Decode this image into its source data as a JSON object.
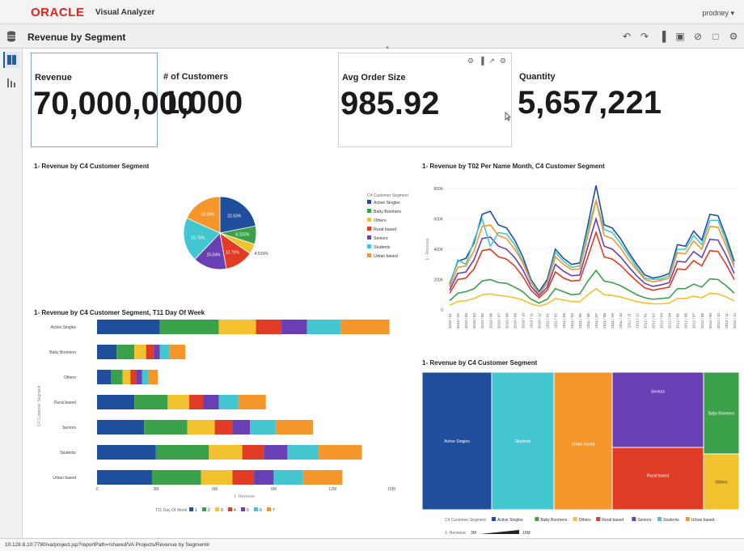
{
  "app": {
    "logo": "ORACLE",
    "name": "Visual Analyzer",
    "user": "prodney ▾"
  },
  "page": {
    "title": "Revenue by Segment"
  },
  "toolbar": {
    "icons": [
      "undo-icon",
      "redo-icon",
      "add-visualization-icon",
      "save-icon",
      "refresh-icon",
      "export-icon",
      "settings-icon"
    ],
    "glyphs": [
      "↶",
      "↷",
      "▐",
      "▣",
      "⊘",
      "□",
      "⚙"
    ]
  },
  "tiles": [
    {
      "label": "Revenue",
      "value": "70,000,000"
    },
    {
      "label": "# of Customers",
      "value": "1,000"
    },
    {
      "label": "Avg Order Size",
      "value": "985.92"
    },
    {
      "label": "Quantity",
      "value": "5,657,221"
    }
  ],
  "tile_tools": [
    "⚙",
    "▐",
    "↗",
    "⚙"
  ],
  "colors": {
    "Active Singles": "#1f4e9c",
    "Baby Boomers": "#3aa14a",
    "Others": "#f2c12e",
    "Rural based": "#e03b24",
    "Seniors": "#6b3fb4",
    "Students": "#43c6d0",
    "Urban based": "#f5962a"
  },
  "status_url": "10.128.8.10:7780/va/project.jsp?reportPath=/shared/VA Projects/Revenue by Segment#",
  "chart_data": [
    {
      "type": "pie",
      "title": "1- Revenue by C4 Customer Segment",
      "legend_title": "C4 Customer Segment",
      "legend_position": "right",
      "categories": [
        "Active Singles",
        "Baby Boomers",
        "Others",
        "Rural based",
        "Seniors",
        "Students",
        "Urban based"
      ],
      "values": [
        22.03,
        8.155,
        4.515,
        12.75,
        15.04,
        19.76,
        18.34
      ],
      "labels": [
        "22.03%",
        "8.155%",
        "4.515%",
        "12.75%",
        "15.04%",
        "19.76%",
        "18.34%"
      ]
    },
    {
      "type": "line",
      "title": "1- Revenue by T02 Per Name Month, C4 Customer Segment",
      "xlabel": "T02 Per Name Month",
      "ylabel": "1 - Revenue",
      "ylim": [
        0,
        800000
      ],
      "y_ticks": [
        "0",
        "200K",
        "400K",
        "600K",
        "800K"
      ],
      "legend_title": "C4 Customer Segment",
      "legend_position": "bottom",
      "x": [
        "2010 / 01",
        "2010 / 02",
        "2010 / 03",
        "2010 / 04",
        "2010 / 05",
        "2010 / 06",
        "2010 / 07",
        "2010 / 08",
        "2010 / 09",
        "2010 / 10",
        "2010 / 11",
        "2010 / 12",
        "2011 / 01",
        "2011 / 02",
        "2011 / 03",
        "2011 / 04",
        "2011 / 05",
        "2011 / 06",
        "2011 / 07",
        "2011 / 08",
        "2011 / 09",
        "2011 / 10",
        "2011 / 11",
        "2011 / 12",
        "2012 / 01",
        "2012 / 02",
        "2012 / 03",
        "2012 / 04",
        "2012 / 05",
        "2012 / 06",
        "2012 / 07",
        "2012 / 08",
        "2012 / 09",
        "2012 / 10",
        "2012 / 11",
        "2012 / 12"
      ],
      "series": [
        {
          "name": "Active Singles",
          "values": [
            170000,
            320000,
            340000,
            440000,
            630000,
            650000,
            560000,
            540000,
            460000,
            350000,
            200000,
            120000,
            200000,
            400000,
            340000,
            300000,
            310000,
            560000,
            820000,
            560000,
            540000,
            470000,
            380000,
            300000,
            230000,
            210000,
            220000,
            240000,
            430000,
            420000,
            520000,
            460000,
            630000,
            620000,
            480000,
            320000
          ]
        },
        {
          "name": "Baby Boomers",
          "values": [
            60000,
            110000,
            120000,
            140000,
            190000,
            200000,
            180000,
            175000,
            150000,
            120000,
            70000,
            45000,
            70000,
            140000,
            120000,
            100000,
            105000,
            190000,
            260000,
            190000,
            180000,
            160000,
            130000,
            100000,
            80000,
            70000,
            75000,
            80000,
            140000,
            140000,
            170000,
            150000,
            205000,
            200000,
            160000,
            110000
          ]
        },
        {
          "name": "Others",
          "values": [
            30000,
            55000,
            60000,
            75000,
            100000,
            105000,
            95000,
            90000,
            80000,
            65000,
            40000,
            25000,
            40000,
            75000,
            65000,
            55000,
            55000,
            100000,
            140000,
            100000,
            95000,
            85000,
            70000,
            55000,
            45000,
            40000,
            40000,
            45000,
            75000,
            75000,
            90000,
            80000,
            110000,
            105000,
            85000,
            60000
          ]
        },
        {
          "name": "Rural based",
          "values": [
            110000,
            200000,
            210000,
            270000,
            390000,
            400000,
            350000,
            335000,
            290000,
            220000,
            130000,
            80000,
            130000,
            250000,
            210000,
            190000,
            195000,
            350000,
            510000,
            350000,
            335000,
            295000,
            240000,
            190000,
            145000,
            130000,
            140000,
            150000,
            270000,
            265000,
            325000,
            290000,
            390000,
            385000,
            300000,
            200000
          ]
        },
        {
          "name": "Seniors",
          "values": [
            130000,
            240000,
            250000,
            330000,
            470000,
            480000,
            420000,
            400000,
            345000,
            265000,
            155000,
            95000,
            150000,
            300000,
            255000,
            225000,
            230000,
            420000,
            600000,
            420000,
            400000,
            350000,
            285000,
            225000,
            175000,
            155000,
            165000,
            180000,
            320000,
            315000,
            385000,
            345000,
            465000,
            460000,
            360000,
            240000
          ]
        },
        {
          "name": "Students",
          "values": [
            160000,
            330000,
            300000,
            460000,
            600000,
            420000,
            510000,
            500000,
            430000,
            320000,
            190000,
            110000,
            180000,
            380000,
            320000,
            280000,
            290000,
            530000,
            720000,
            530000,
            510000,
            440000,
            360000,
            280000,
            210000,
            200000,
            205000,
            225000,
            400000,
            400000,
            490000,
            430000,
            590000,
            590000,
            450000,
            300000
          ]
        },
        {
          "name": "Urban based",
          "values": [
            150000,
            280000,
            290000,
            390000,
            550000,
            560000,
            490000,
            470000,
            400000,
            310000,
            180000,
            105000,
            175000,
            350000,
            300000,
            265000,
            270000,
            490000,
            720000,
            490000,
            470000,
            410000,
            330000,
            265000,
            200000,
            185000,
            195000,
            210000,
            375000,
            370000,
            455000,
            400000,
            550000,
            545000,
            420000,
            280000
          ]
        }
      ]
    },
    {
      "type": "bar",
      "orientation": "horizontal-stacked",
      "title": "1- Revenue by C4 Customer Segment, T11 Day Of Week",
      "xlabel": "1- Revenue",
      "ylabel": "C4 Customer Segment",
      "xlim": [
        0,
        15000000
      ],
      "x_ticks": [
        "0",
        "3M",
        "6M",
        "9M",
        "12M",
        "15M"
      ],
      "legend_title": "T11 Day Of Week",
      "legend_position": "bottom",
      "categories": [
        "Active Singles",
        "Baby Boomers",
        "Others",
        "Rural based",
        "Seniors",
        "Students",
        "Urban based"
      ],
      "series": [
        {
          "name": "1",
          "values": [
            3200000,
            1000000,
            700000,
            1900000,
            2400000,
            3000000,
            2800000
          ]
        },
        {
          "name": "2",
          "values": [
            3000000,
            900000,
            600000,
            1700000,
            2200000,
            2700000,
            2500000
          ]
        },
        {
          "name": "3",
          "values": [
            1900000,
            600000,
            400000,
            1100000,
            1400000,
            1700000,
            1600000
          ]
        },
        {
          "name": "4",
          "values": [
            1300000,
            400000,
            300000,
            700000,
            900000,
            1100000,
            1100000
          ]
        },
        {
          "name": "5",
          "values": [
            1300000,
            300000,
            300000,
            800000,
            900000,
            1200000,
            1000000
          ]
        },
        {
          "name": "6",
          "values": [
            1700000,
            500000,
            300000,
            1000000,
            1300000,
            1600000,
            1500000
          ]
        },
        {
          "name": "7",
          "values": [
            2500000,
            800000,
            500000,
            1400000,
            1900000,
            2200000,
            2000000
          ]
        }
      ]
    },
    {
      "type": "treemap",
      "title": "1- Revenue by C4 Customer Segment",
      "legend_title": "C4 Customer Segment",
      "legend_position": "bottom",
      "size_legend": {
        "label": "1- Revenue",
        "min": "3M",
        "max": "15M"
      },
      "categories": [
        "Active Singles",
        "Students",
        "Urban based",
        "Seniors",
        "Rural based",
        "Baby Boomers",
        "Others"
      ],
      "values": [
        15400000,
        13800000,
        12800000,
        10500000,
        8900000,
        5700000,
        3200000
      ]
    }
  ]
}
